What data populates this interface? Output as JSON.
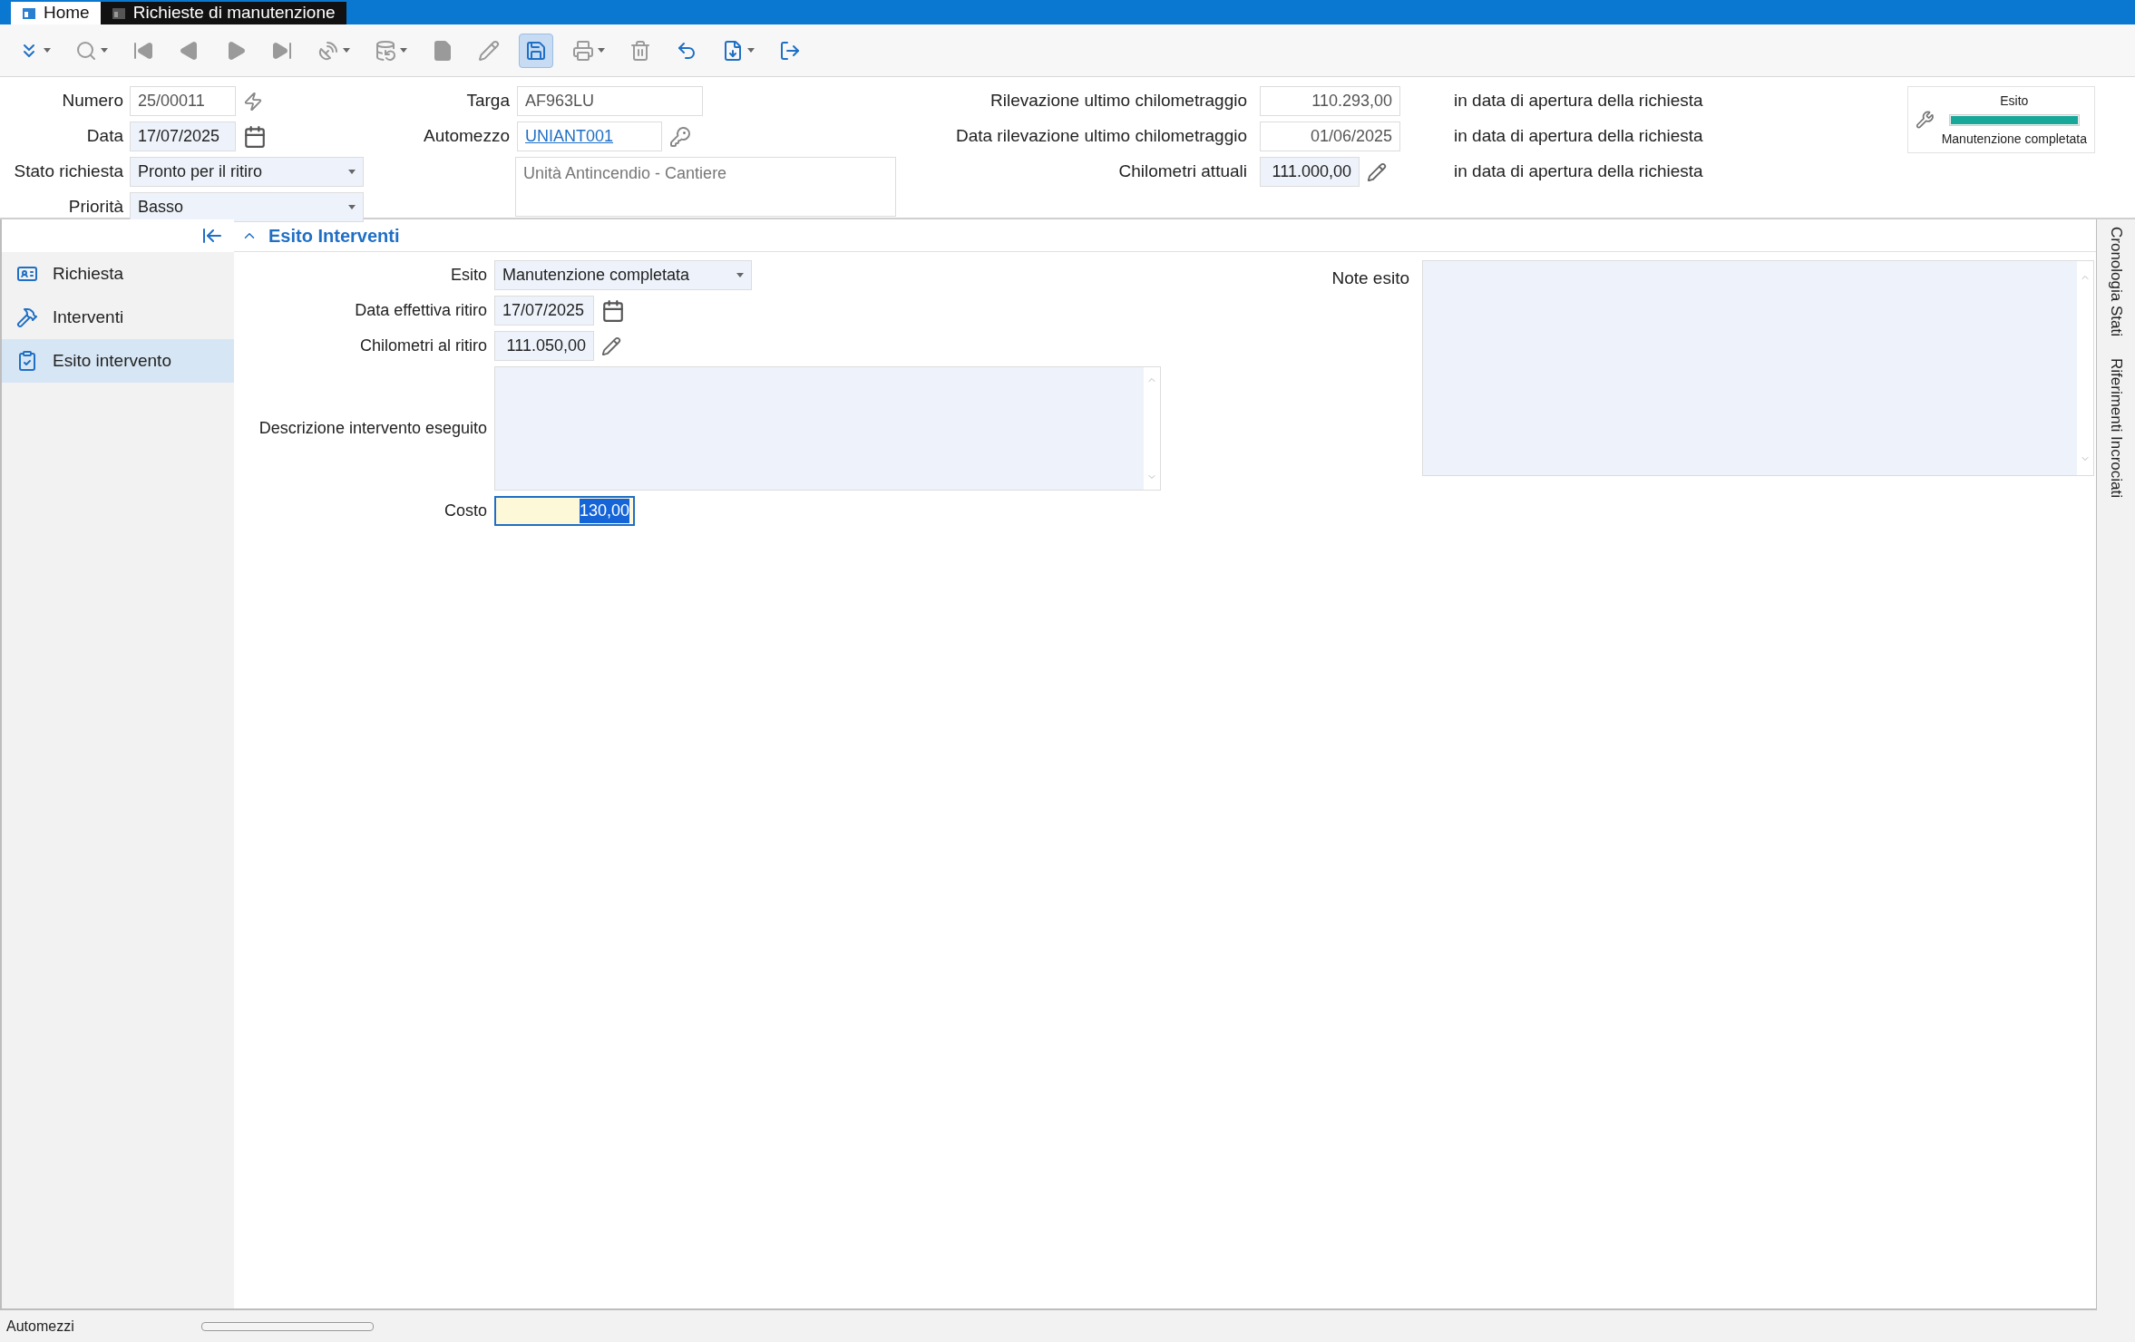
{
  "tabs": [
    {
      "label": "Home",
      "selected": false
    },
    {
      "label": "Richieste di manutenzione",
      "selected": true
    }
  ],
  "toolbar": [
    {
      "kind": "expand",
      "disabled": false,
      "menu": true,
      "highlighted": false
    },
    {
      "kind": "search",
      "disabled": true,
      "menu": true,
      "highlighted": false
    },
    {
      "kind": "first",
      "disabled": true,
      "menu": false,
      "highlighted": false
    },
    {
      "kind": "previous",
      "disabled": true,
      "menu": false,
      "highlighted": false
    },
    {
      "kind": "next",
      "disabled": true,
      "menu": false,
      "highlighted": false
    },
    {
      "kind": "last",
      "disabled": true,
      "menu": false,
      "highlighted": false
    },
    {
      "kind": "dish",
      "disabled": true,
      "menu": true,
      "highlighted": false
    },
    {
      "kind": "database",
      "disabled": true,
      "menu": true,
      "highlighted": false
    },
    {
      "kind": "new",
      "disabled": true,
      "menu": false,
      "highlighted": false
    },
    {
      "kind": "edit",
      "disabled": true,
      "menu": false,
      "highlighted": false
    },
    {
      "kind": "save",
      "disabled": false,
      "menu": false,
      "highlighted": true
    },
    {
      "kind": "print",
      "disabled": true,
      "menu": true,
      "highlighted": false
    },
    {
      "kind": "delete",
      "disabled": true,
      "menu": false,
      "highlighted": false
    },
    {
      "kind": "undo",
      "disabled": false,
      "menu": false,
      "highlighted": false
    },
    {
      "kind": "export",
      "disabled": false,
      "menu": true,
      "highlighted": false
    },
    {
      "kind": "exit",
      "disabled": false,
      "menu": false,
      "highlighted": false
    }
  ],
  "header": {
    "left": [
      {
        "label": "Numero",
        "value": "25/00011",
        "kind": "number"
      },
      {
        "label": "Data",
        "value": "17/07/2025",
        "kind": "date"
      },
      {
        "label": "Stato richiesta",
        "value": "Pronto per il ritiro",
        "kind": "select"
      },
      {
        "label": "Priorità",
        "value": "Basso",
        "kind": "select"
      }
    ],
    "middle": [
      {
        "label": "Targa",
        "value": "AF963LU",
        "kind": "readonly"
      },
      {
        "label": "Automezzo",
        "value": "UNIANT001",
        "kind": "link"
      }
    ],
    "vehicle_description": "Unità Antincendio - Cantiere",
    "right": [
      {
        "label": "Rilevazione ultimo chilometraggio",
        "value": "110.293,00",
        "kind": "readonly",
        "note": "in data di apertura della richiesta"
      },
      {
        "label": "Data rilevazione ultimo chilometraggio",
        "value": "01/06/2025",
        "kind": "readonly",
        "note": "in data di apertura della richiesta"
      },
      {
        "label": "Chilometri attuali",
        "value": "111.000,00",
        "kind": "editable",
        "note": "in data di apertura della richiesta"
      }
    ],
    "status_card": {
      "title": "Esito",
      "level": 1,
      "value": "Manutenzione completata"
    }
  },
  "side_tabs": [
    "Cronologia Stati",
    "Riferimenti Incrociati"
  ],
  "nav": [
    {
      "label": "Richiesta",
      "kind": "request",
      "selected": false
    },
    {
      "label": "Interventi",
      "kind": "work",
      "selected": false
    },
    {
      "label": "Esito intervento",
      "kind": "outcome",
      "selected": true
    }
  ],
  "section": {
    "title": "Esito Interventi",
    "expanded": true,
    "fields": [
      {
        "label": "Esito",
        "value": "Manutenzione completata",
        "kind": "select"
      },
      {
        "label": "Data effettiva ritiro",
        "value": "17/07/2025",
        "kind": "date"
      },
      {
        "label": "Chilometri al ritiro",
        "value": "111.050,00",
        "kind": "editable"
      },
      {
        "label": "Descrizione intervento eseguito",
        "kind": "textarea"
      },
      {
        "label": "Costo",
        "value": "130,00",
        "kind": "focused"
      }
    ],
    "notes_label": "Note esito"
  },
  "status_bar": {
    "text": "Automezzi",
    "level": 0
  }
}
